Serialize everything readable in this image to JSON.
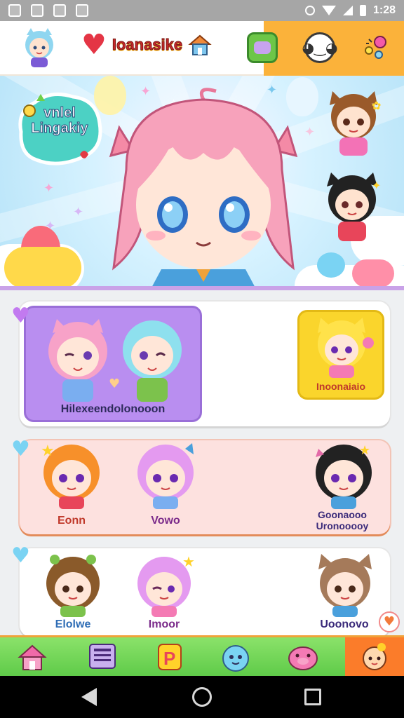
{
  "status_bar": {
    "time": "1:28",
    "left_icons": [
      "image-icon",
      "settings-icon",
      "sync-icon",
      "notification-icon"
    ],
    "right_icons": [
      "alarm-icon",
      "wifi-icon",
      "signal-icon",
      "battery-icon"
    ]
  },
  "header": {
    "logo_text": "Ioanasike",
    "buttons": [
      "chat-icon",
      "speech-bubble-icon",
      "party-icon"
    ]
  },
  "banner": {
    "badge_line1": "vnlel",
    "badge_line2": "Lingakiy"
  },
  "cards": {
    "featured": {
      "duo_label": "Hilexeendolonooon",
      "single_label": "Inoonaiaio"
    },
    "row2": {
      "items": [
        {
          "label": "Eonn",
          "color": "#c0392b"
        },
        {
          "label": "Vowo",
          "color": "#7a2a8a"
        },
        {
          "label_line1": "Goonaooo",
          "label_line2": "Uronooooy",
          "color": "#3a2a7a"
        }
      ]
    },
    "row3": {
      "items": [
        {
          "label": "Elolwe",
          "color": "#2f6db5"
        },
        {
          "label": "Imoor",
          "color": "#7a2a8a"
        },
        {
          "label": "Uoonovo",
          "color": "#3a2a7a"
        }
      ]
    }
  },
  "bottom_nav": {
    "items": [
      "home-icon",
      "news-icon",
      "p-badge-icon",
      "blob-character-icon",
      "pig-icon",
      "character-icon"
    ],
    "active_index": 5
  },
  "colors": {
    "header_orange": "#fbb23a",
    "nav_green": "#6fd253",
    "nav_active": "#fb7c2a",
    "featured_purple": "#b98ef0",
    "featured_yellow": "#fad52c",
    "row2_pink": "#fde1df"
  }
}
